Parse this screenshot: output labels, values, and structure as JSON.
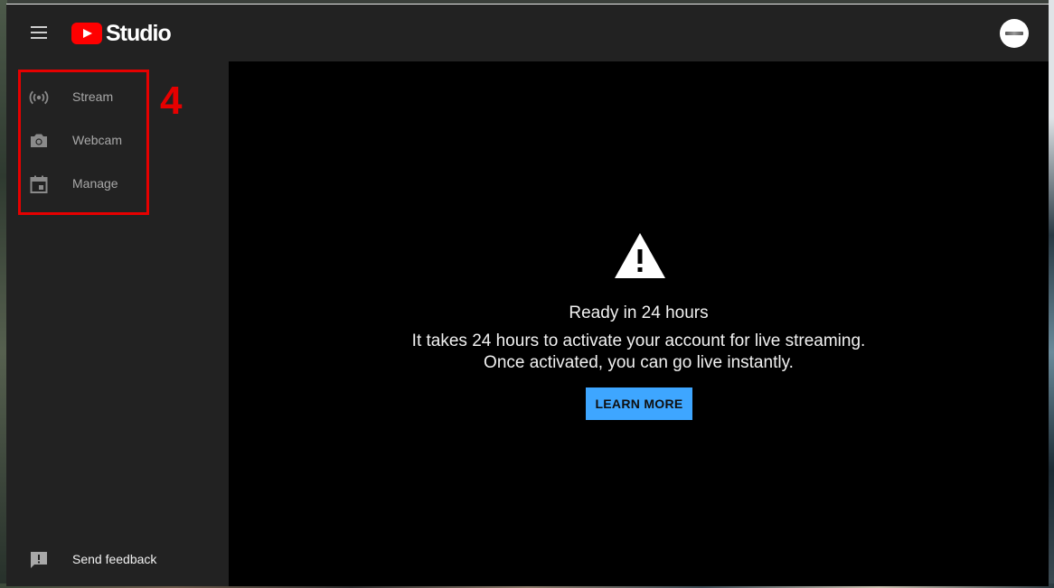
{
  "header": {
    "logo_text": "Studio",
    "avatar_text": ""
  },
  "sidebar": {
    "items": [
      {
        "label": "Stream",
        "icon": "stream-icon"
      },
      {
        "label": "Webcam",
        "icon": "camera-icon"
      },
      {
        "label": "Manage",
        "icon": "calendar-icon"
      }
    ],
    "feedback_label": "Send feedback"
  },
  "annotation": {
    "number": "4",
    "color": "#e60000"
  },
  "main": {
    "title": "Ready in 24 hours",
    "body": "It takes 24 hours to activate your account for live streaming. Once activated, you can go live instantly.",
    "button_label": "LEARN MORE"
  },
  "colors": {
    "brand_red": "#ff0000",
    "accent_blue": "#3ea6ff",
    "sidebar_bg": "#222222",
    "content_bg": "#000000"
  }
}
